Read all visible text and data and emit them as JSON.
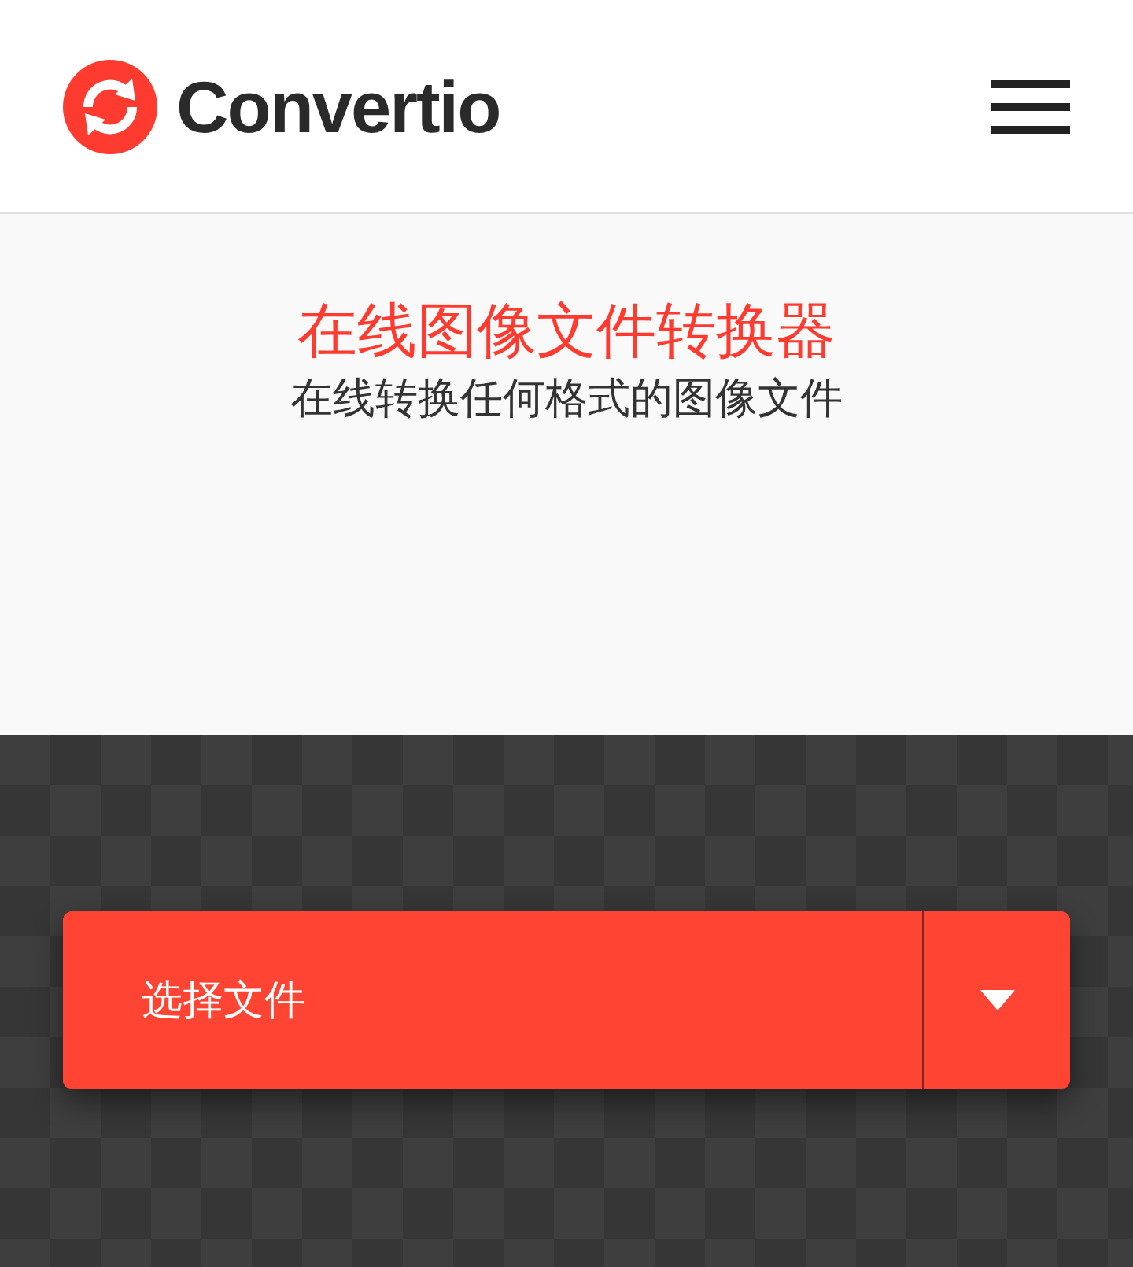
{
  "header": {
    "logo_text": "Convertio"
  },
  "hero": {
    "title": "在线图像文件转换器",
    "subtitle": "在线转换任何格式的图像文件"
  },
  "upload": {
    "button_label": "选择文件"
  }
}
